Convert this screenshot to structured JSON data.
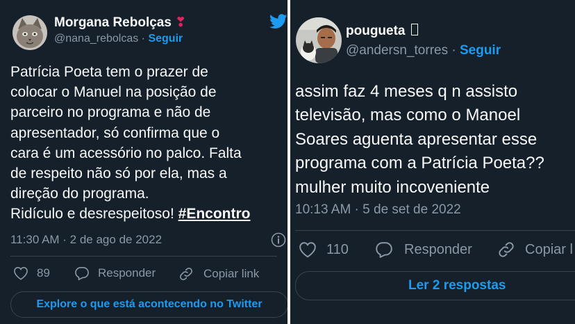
{
  "tweets": [
    {
      "name": "Morgana Rebolças",
      "name_emoji": "❣",
      "handle": "@nana_rebolcas",
      "separator": "·",
      "follow": "Seguir",
      "text_lines": [
        "Patrícia Poeta tem o prazer de",
        "colocar o Manuel na posição de",
        "parceiro no programa e não de",
        "apresentador, só confirma que o",
        "cara é um acessório no palco. Falta",
        "de respeito não só por ela, mas a",
        "direção do programa."
      ],
      "text_last": "Ridículo e desrespeitoso!",
      "hashtag": "#Encontro",
      "timestamp": "11:30 AM · 2 de ago de 2022",
      "likes": "89",
      "reply": "Responder",
      "copy": "Copiar link",
      "explore": "Explore o que está acontecendo no Twitter"
    },
    {
      "name": "pougueta",
      "name_suffix": "",
      "handle": "@andersn_torres",
      "separator": "·",
      "follow": "Seguir",
      "text_lines": [
        "assim faz 4 meses q n assisto",
        "televisão, mas como o Manoel",
        "Soares aguenta apresentar esse",
        "programa com a Patrícia Poeta??",
        "mulher muito incoveniente"
      ],
      "timestamp": "10:13 AM · 5 de set de 2022",
      "likes": "110",
      "reply": "Responder",
      "copy": "Copiar l",
      "replies_button": "Ler 2 respostas"
    }
  ],
  "colors": {
    "background": "#15202b",
    "text": "#f7f9f9",
    "secondary": "#8b98a5",
    "accent": "#1d9bf0",
    "divider": "#38444d"
  },
  "icons": [
    "twitter-bird-icon",
    "info-icon",
    "heart-icon",
    "reply-icon",
    "link-icon"
  ]
}
